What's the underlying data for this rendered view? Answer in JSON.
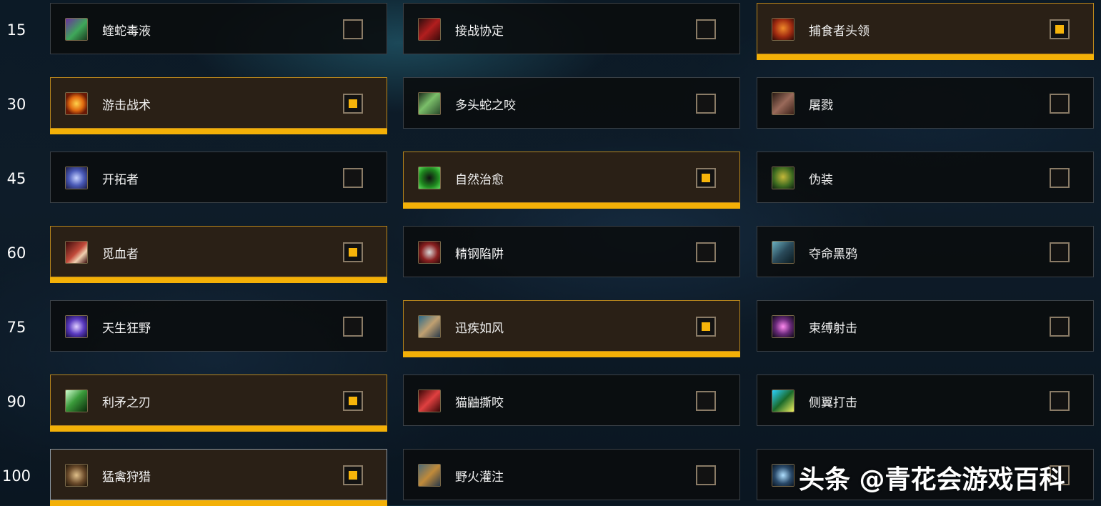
{
  "rows": [
    {
      "level": "15",
      "talents": [
        {
          "name": "蝰蛇毒液",
          "icon": "viper-venom-icon",
          "selected": false
        },
        {
          "name": "接战协定",
          "icon": "terms-of-engagement-icon",
          "selected": false
        },
        {
          "name": "捕食者头领",
          "icon": "alpha-predator-icon",
          "selected": true
        }
      ]
    },
    {
      "level": "30",
      "talents": [
        {
          "name": "游击战术",
          "icon": "guerrilla-tactics-icon",
          "selected": true
        },
        {
          "name": "多头蛇之咬",
          "icon": "hydras-bite-icon",
          "selected": false
        },
        {
          "name": "屠戮",
          "icon": "butchery-icon",
          "selected": false
        }
      ]
    },
    {
      "level": "45",
      "talents": [
        {
          "name": "开拓者",
          "icon": "trailblazer-icon",
          "selected": false
        },
        {
          "name": "自然治愈",
          "icon": "natural-mending-icon",
          "selected": true
        },
        {
          "name": "伪装",
          "icon": "camouflage-icon",
          "selected": false
        }
      ]
    },
    {
      "level": "60",
      "talents": [
        {
          "name": "觅血者",
          "icon": "bloodseeker-icon",
          "selected": true
        },
        {
          "name": "精钢陷阱",
          "icon": "steel-trap-icon",
          "selected": false
        },
        {
          "name": "夺命黑鸦",
          "icon": "a-murder-of-crows-icon",
          "selected": false
        }
      ]
    },
    {
      "level": "75",
      "talents": [
        {
          "name": "天生狂野",
          "icon": "born-to-be-wild-icon",
          "selected": false
        },
        {
          "name": "迅疾如风",
          "icon": "posthaste-icon",
          "selected": true
        },
        {
          "name": "束缚射击",
          "icon": "binding-shot-icon",
          "selected": false
        }
      ]
    },
    {
      "level": "90",
      "talents": [
        {
          "name": "利矛之刃",
          "icon": "tip-of-the-spear-icon",
          "selected": true
        },
        {
          "name": "猫鼬撕咬",
          "icon": "mongoose-bite-icon",
          "selected": false
        },
        {
          "name": "侧翼打击",
          "icon": "flanking-strike-icon",
          "selected": false
        }
      ]
    },
    {
      "level": "100",
      "talents": [
        {
          "name": "猛禽狩猎",
          "icon": "birds-of-prey-icon",
          "selected": true
        },
        {
          "name": "野火灌注",
          "icon": "wildfire-infusion-icon",
          "selected": false
        },
        {
          "name": "",
          "icon": "chakrams-icon",
          "selected": false
        }
      ]
    }
  ],
  "watermark": "头条 @青花会游戏百科",
  "colors": {
    "accent": "#f3b007",
    "selected_bg": "#2a2016",
    "unselected_bg": "#0a0c0e"
  }
}
